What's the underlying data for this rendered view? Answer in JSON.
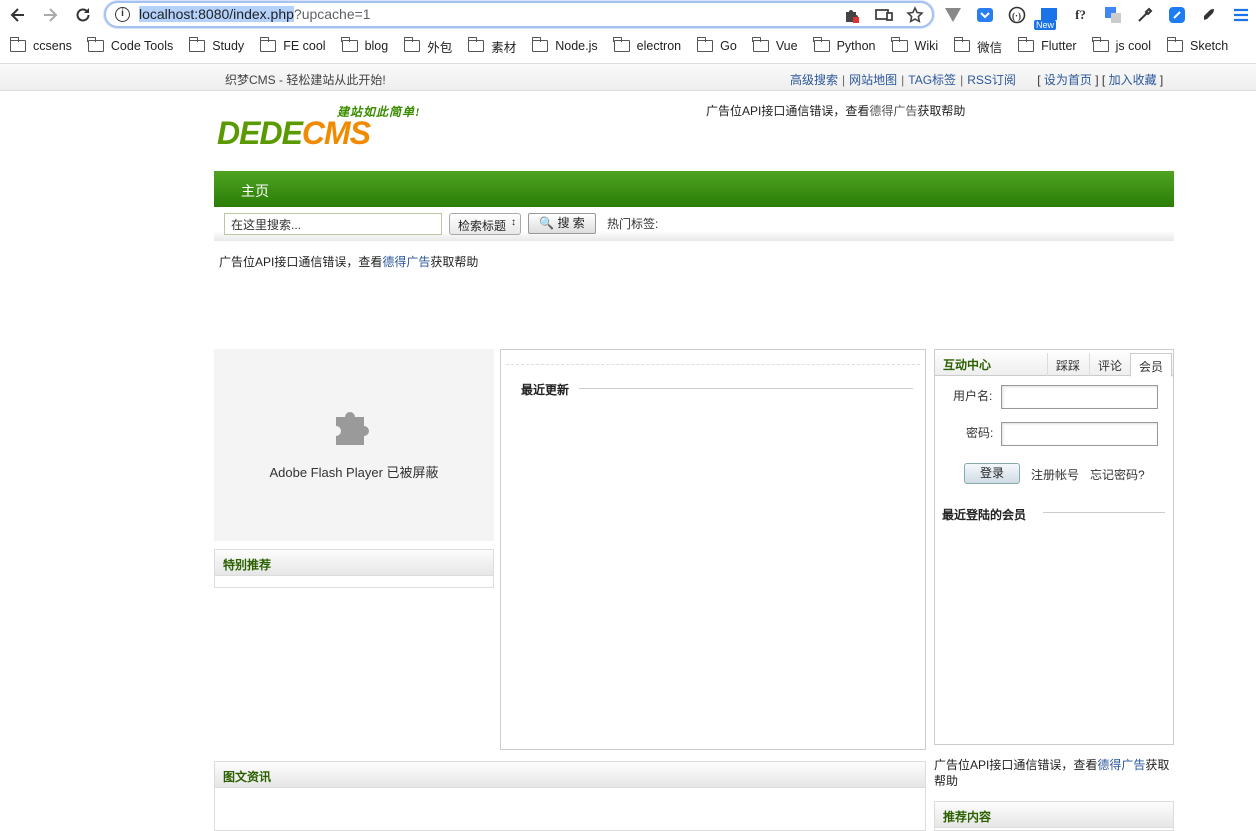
{
  "browser": {
    "url_host": "localhost:8080/index.php",
    "url_query": "?upcache=1",
    "bookmarks": [
      "ccsens",
      "Code Tools",
      "Study",
      "FE cool",
      "blog",
      "外包",
      "素材",
      "Node.js",
      "electron",
      "Go",
      "Vue",
      "Python",
      "Wiki",
      "微信",
      "Flutter",
      "js cool",
      "Sketch"
    ],
    "ext_new_badge": "New",
    "ext_f_label": "f?"
  },
  "topbar": {
    "welcome": "织梦CMS - 轻松建站从此开始!",
    "links": [
      "高级搜索",
      "网站地图",
      "TAG标签",
      "RSS订阅"
    ],
    "set_home": "设为首页",
    "add_fav": "加入收藏"
  },
  "logo": {
    "slogan": "建站如此简单!",
    "text_a": "DEDE",
    "text_b": "CMS"
  },
  "ad": {
    "pre": "广告位API接口通信错误，查看",
    "link": "德得广告",
    "post": "获取帮助",
    "post_a": "获取",
    "post_b": "帮助"
  },
  "nav": {
    "home": "主页"
  },
  "search": {
    "placeholder": "在这里搜索...",
    "select": "检索标题",
    "button": "搜 索",
    "hot_tags": "热门标签:"
  },
  "left": {
    "flash_msg": "Adobe Flash Player 已被屏蔽",
    "special": "特别推荐"
  },
  "center": {
    "recent": "最近更新"
  },
  "right": {
    "title": "互动中心",
    "tabs": [
      "踩踩",
      "评论",
      "会员"
    ],
    "username_label": "用户名:",
    "password_label": "密码:",
    "login": "登录",
    "register": "注册帐号",
    "forgot": "忘记密码?",
    "recent_members": "最近登陆的会员"
  },
  "bottom": {
    "pic_news": "图文资讯",
    "recommend": "推荐内容"
  }
}
